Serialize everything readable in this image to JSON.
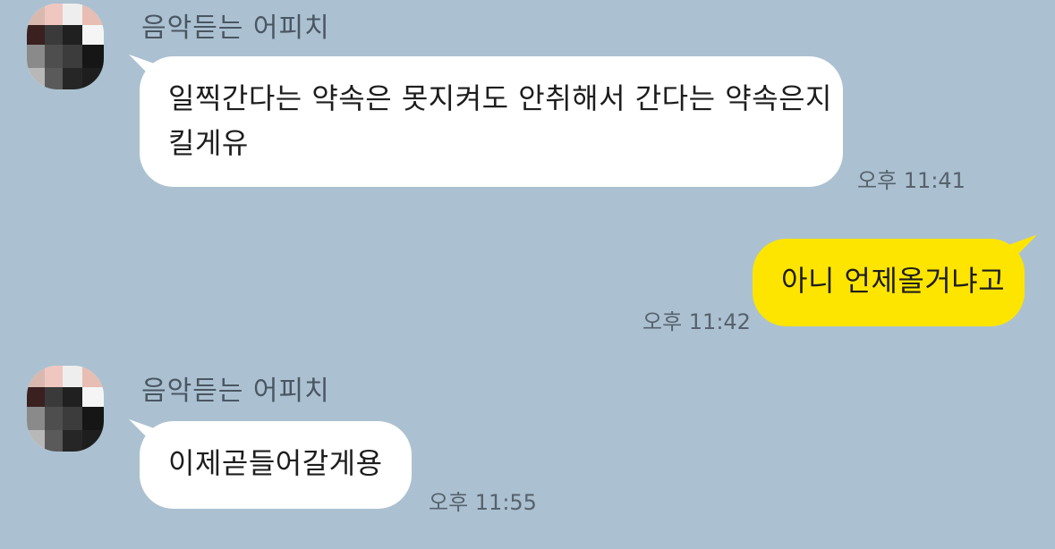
{
  "messages": [
    {
      "sender": "음악듣는 어피치",
      "text_line1": "일찍간다는 약속은 못지켜도 안취해서 간다는 약속은지",
      "text_line2": "킬게유",
      "time": "오후 11:41"
    },
    {
      "text": "아니 언제올거냐고",
      "time": "오후 11:42"
    },
    {
      "sender": "음악듣는 어피치",
      "text": "이제곧들어갈게용",
      "time": "오후 11:55"
    }
  ],
  "colors": {
    "background": "#abc1d1",
    "incoming_bubble": "#ffffff",
    "outgoing_bubble": "#fee500"
  }
}
